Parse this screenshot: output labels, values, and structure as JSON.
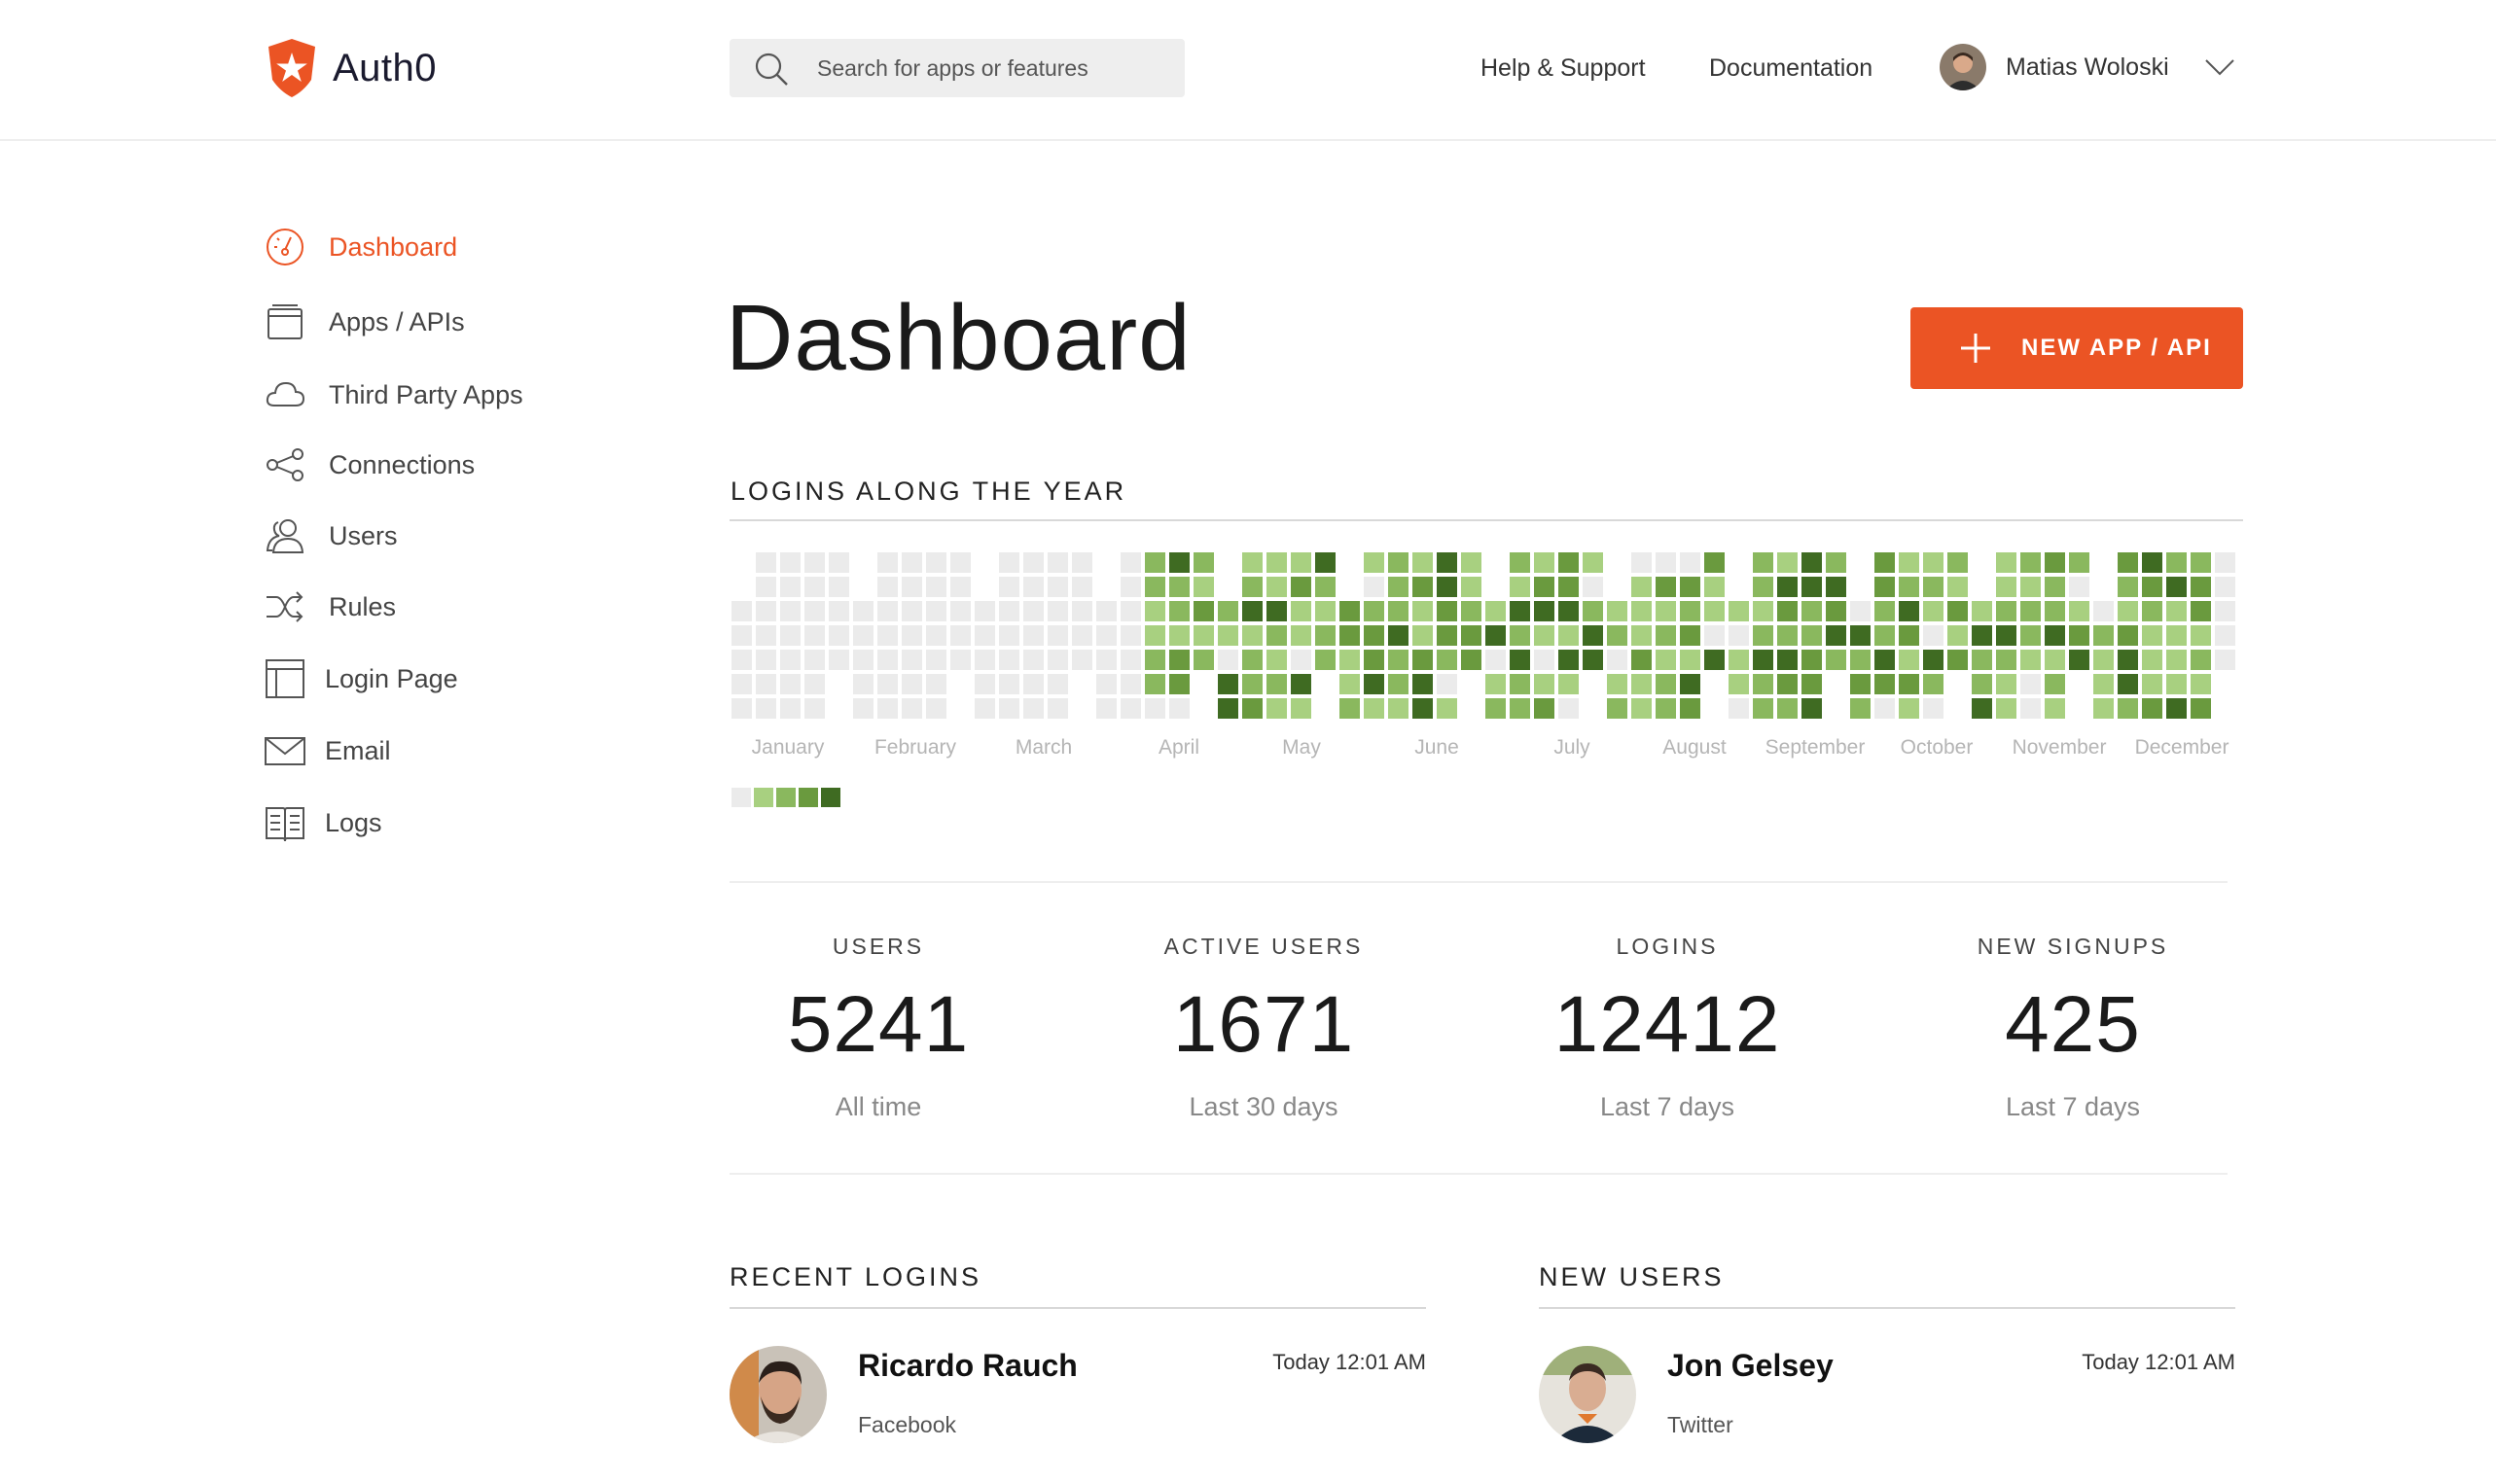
{
  "header": {
    "brand": "Auth0",
    "search_placeholder": "Search for apps or features",
    "help_link": "Help & Support",
    "docs_link": "Documentation",
    "user_name": "Matias Woloski",
    "accent_color": "#eb5424"
  },
  "sidebar": {
    "items": [
      {
        "label": "Dashboard",
        "icon": "speedometer-icon",
        "active": true
      },
      {
        "label": "Apps / APIs",
        "icon": "window-icon"
      },
      {
        "label": "Third Party Apps",
        "icon": "cloud-icon"
      },
      {
        "label": "Connections",
        "icon": "share-nodes-icon"
      },
      {
        "label": "Users",
        "icon": "users-icon"
      },
      {
        "label": "Rules",
        "icon": "shuffle-icon"
      },
      {
        "label": "Login Page",
        "icon": "layout-icon"
      },
      {
        "label": "Email",
        "icon": "envelope-icon"
      },
      {
        "label": "Logs",
        "icon": "book-icon"
      }
    ]
  },
  "main": {
    "title": "Dashboard",
    "new_button_label": "NEW APP / API"
  },
  "logins_chart": {
    "title": "LOGINS ALONG THE YEAR",
    "months": [
      "January",
      "February",
      "March",
      "April",
      "May",
      "June",
      "July",
      "August",
      "September",
      "October",
      "November",
      "December"
    ],
    "palette": [
      "#ebebeb",
      "#a8d080",
      "#8ab85e",
      "#6a9a3e",
      "#3f6b22"
    ],
    "legend_levels": [
      0,
      1,
      2,
      3,
      4
    ]
  },
  "stats": [
    {
      "label": "USERS",
      "value": "5241",
      "period": "All time"
    },
    {
      "label": "ACTIVE USERS",
      "value": "1671",
      "period": "Last 30 days"
    },
    {
      "label": "LOGINS",
      "value": "12412",
      "period": "Last 7 days"
    },
    {
      "label": "NEW SIGNUPS",
      "value": "425",
      "period": "Last 7 days"
    }
  ],
  "recent_logins": {
    "title": "RECENT LOGINS",
    "items": [
      {
        "name": "Ricardo Rauch",
        "connection": "Facebook",
        "time": "Today 12:01 AM"
      }
    ]
  },
  "new_users": {
    "title": "NEW USERS",
    "items": [
      {
        "name": "Jon Gelsey",
        "connection": "Twitter",
        "time": "Today 12:01 AM"
      }
    ]
  }
}
